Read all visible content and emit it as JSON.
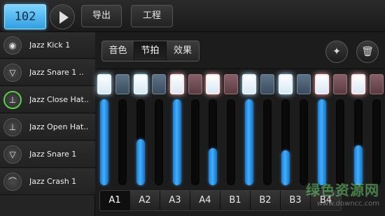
{
  "toolbar": {
    "bpm": "102",
    "play_icon": "play-icon",
    "export_label": "导出",
    "project_label": "工程"
  },
  "instruments": [
    {
      "label": "Jazz Kick 1",
      "icon": "kick-drum-icon",
      "glyph": "◉",
      "active": false
    },
    {
      "label": "Jazz Snare 1 ..",
      "icon": "snare-drum-icon",
      "glyph": "▽",
      "active": false
    },
    {
      "label": "Jazz Close Hat..",
      "icon": "hihat-icon",
      "glyph": "⊥",
      "active": true
    },
    {
      "label": "Jazz Open Hat..",
      "icon": "hihat-icon",
      "glyph": "⊥",
      "active": false
    },
    {
      "label": "Jazz Snare 1",
      "icon": "snare-drum-icon",
      "glyph": "▽",
      "active": false
    },
    {
      "label": "Jazz Crash 1",
      "icon": "cymbal-icon",
      "glyph": "⌒",
      "active": false
    }
  ],
  "tabs": [
    {
      "label": "音色",
      "selected": false
    },
    {
      "label": "节拍",
      "selected": true
    },
    {
      "label": "效果",
      "selected": false
    }
  ],
  "actions": {
    "wand_icon": "magic-wand-icon",
    "trash_icon": "trash-icon"
  },
  "steps": [
    {
      "on": true,
      "accent": "blue"
    },
    {
      "on": false,
      "accent": "blue"
    },
    {
      "on": true,
      "accent": "blue"
    },
    {
      "on": false,
      "accent": "blue"
    },
    {
      "on": true,
      "accent": "red"
    },
    {
      "on": false,
      "accent": "red"
    },
    {
      "on": true,
      "accent": "red"
    },
    {
      "on": false,
      "accent": "red"
    },
    {
      "on": true,
      "accent": "blue"
    },
    {
      "on": false,
      "accent": "blue"
    },
    {
      "on": true,
      "accent": "blue"
    },
    {
      "on": false,
      "accent": "blue"
    },
    {
      "on": true,
      "accent": "red"
    },
    {
      "on": false,
      "accent": "red"
    },
    {
      "on": true,
      "accent": "red"
    },
    {
      "on": false,
      "accent": "red"
    }
  ],
  "velocities": [
    1.0,
    0,
    0.54,
    0,
    1.0,
    0,
    0.43,
    0,
    1.0,
    0,
    0.41,
    0,
    1.0,
    0,
    0.46,
    0
  ],
  "patterns": [
    {
      "label": "A1",
      "selected": true
    },
    {
      "label": "A2",
      "selected": false
    },
    {
      "label": "A3",
      "selected": false
    },
    {
      "label": "A4",
      "selected": false
    },
    {
      "label": "B1",
      "selected": false
    },
    {
      "label": "B2",
      "selected": false
    },
    {
      "label": "B3",
      "selected": false
    },
    {
      "label": "B4",
      "selected": false
    }
  ],
  "watermark": {
    "main": "绿色资源网",
    "sub": "www.downcc.com"
  }
}
